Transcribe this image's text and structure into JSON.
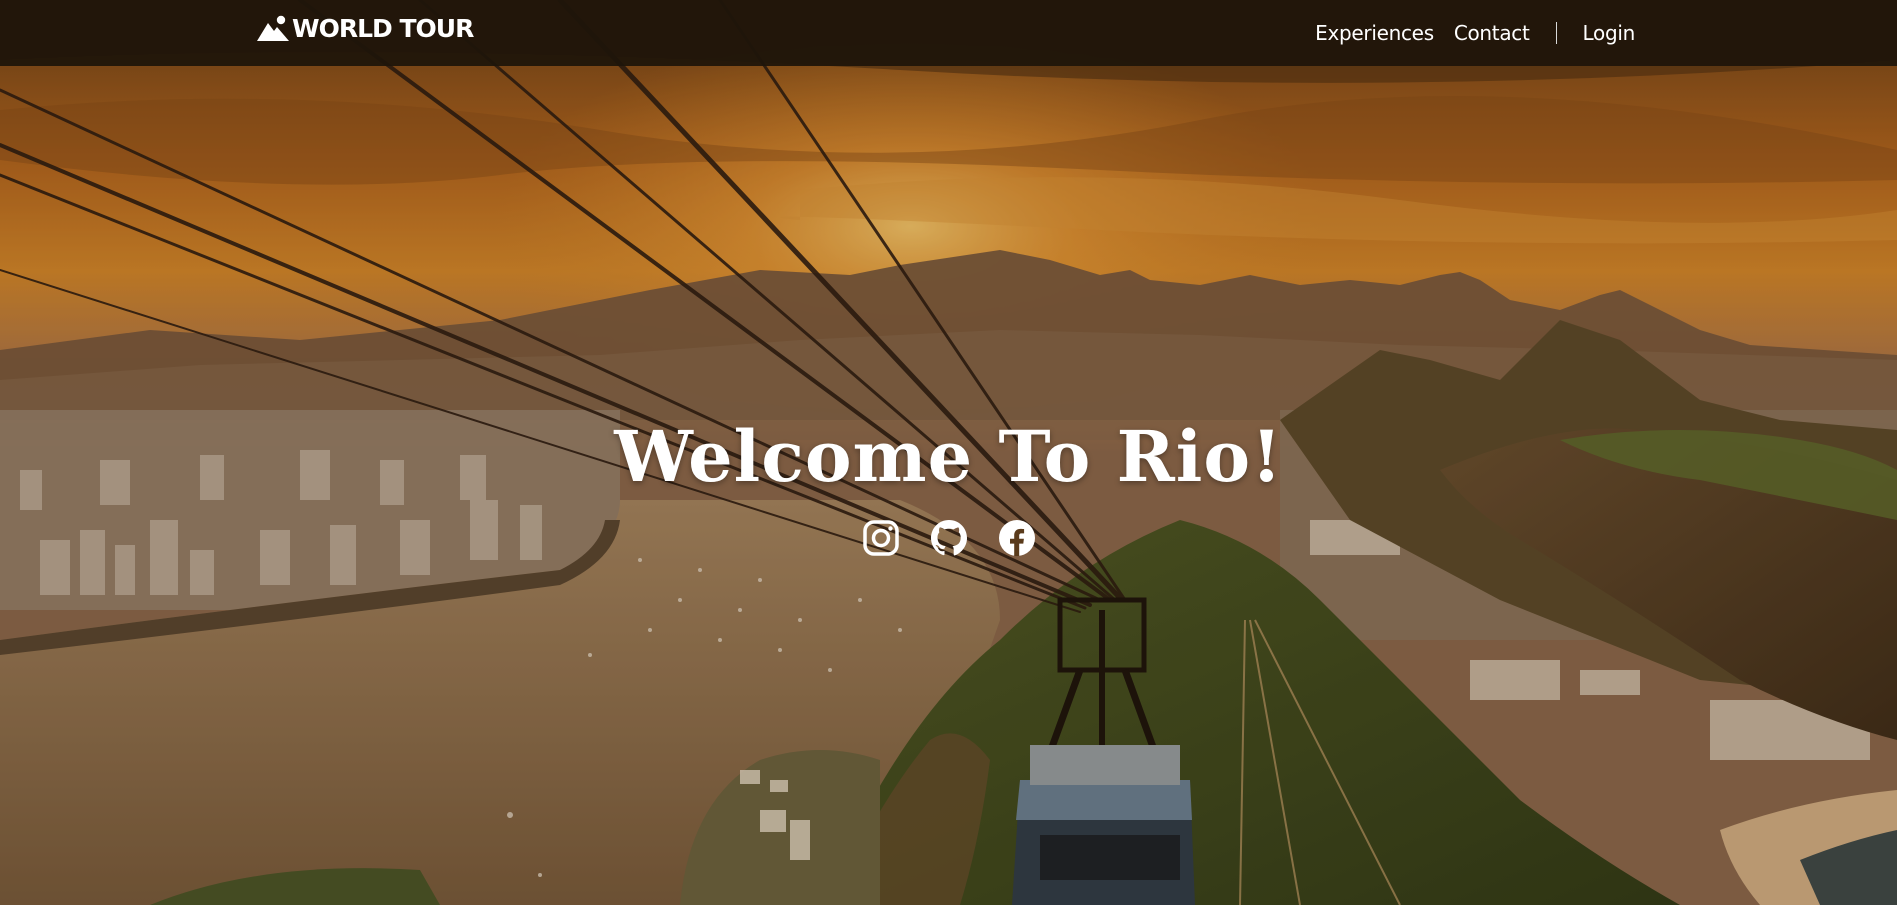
{
  "brand": {
    "name": "WORLD TOUR",
    "icon": "mountain-icon"
  },
  "nav": {
    "links": [
      {
        "label": "Experiences"
      },
      {
        "label": "Contact"
      }
    ],
    "login_label": "Login"
  },
  "hero": {
    "title": "Welcome To Rio!",
    "background": "sunset-rio-cable-car-photo",
    "social_icons": [
      "instagram-icon",
      "github-icon",
      "facebook-icon"
    ]
  },
  "colors": {
    "navbar": "#1e140a",
    "sky_top": "#7a4a1c",
    "sun": "#f5b040",
    "text": "#ffffff"
  }
}
